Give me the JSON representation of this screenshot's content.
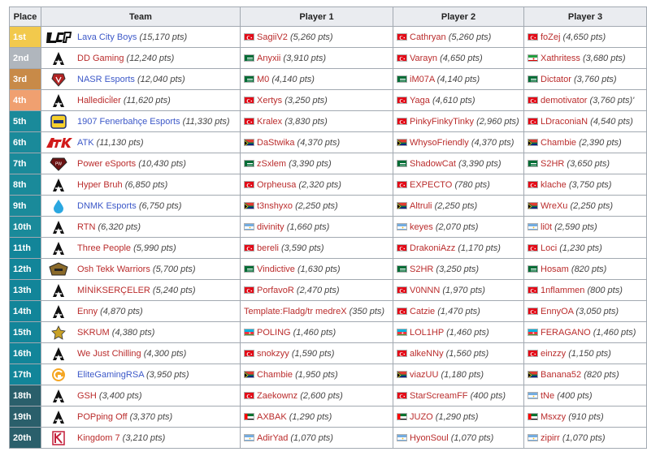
{
  "headers": {
    "place": "Place",
    "team": "Team",
    "p1": "Player 1",
    "p2": "Player 2",
    "p3": "Player 3"
  },
  "place_colors": {
    "1": "#f2c94c",
    "2": "#b0b6bd",
    "3": "#c88a48",
    "4": "#f0a070",
    "top": "#1a8a9a",
    "mid": "#128599",
    "low": "#2a5f6b"
  },
  "rows": [
    {
      "place": "1st",
      "team": "Lava City Boys",
      "team_pts": "(15,170 pts)",
      "logo": "lcb-logo",
      "team_red": false,
      "p1": {
        "flag": "tr",
        "name": "SagiiV2",
        "pts": "(5,260 pts)"
      },
      "p2": {
        "flag": "tr",
        "name": "Cathryan",
        "pts": "(5,260 pts)"
      },
      "p3": {
        "flag": "tr",
        "name": "foZej",
        "pts": "(4,650 pts)"
      }
    },
    {
      "place": "2nd",
      "team": "DD Gaming",
      "team_pts": "(12,240 pts)",
      "logo": "a-logo",
      "team_red": true,
      "p1": {
        "flag": "sa",
        "name": "Anyxii",
        "pts": "(3,910 pts)"
      },
      "p2": {
        "flag": "tr",
        "name": "Varayn",
        "pts": "(4,650 pts)"
      },
      "p3": {
        "flag": "ir",
        "name": "Xathritess",
        "pts": "(3,680 pts)"
      }
    },
    {
      "place": "3rd",
      "team": "NASR Esports",
      "team_pts": "(12,040 pts)",
      "logo": "nasr-logo",
      "team_red": false,
      "p1": {
        "flag": "sa",
        "name": "M0",
        "pts": "(4,140 pts)"
      },
      "p2": {
        "flag": "sa",
        "name": "iM07A",
        "pts": "(4,140 pts)"
      },
      "p3": {
        "flag": "sa",
        "name": "Dictator",
        "pts": "(3,760 pts)"
      }
    },
    {
      "place": "4th",
      "team": "Halledici̇ler",
      "team_pts": "(11,620 pts)",
      "logo": "a-logo",
      "team_red": true,
      "p1": {
        "flag": "tr",
        "name": "Xertys",
        "pts": "(3,250 pts)"
      },
      "p2": {
        "flag": "tr",
        "name": "Yaga",
        "pts": "(4,610 pts)"
      },
      "p3": {
        "flag": "tr",
        "name": "demotivator",
        "pts": "(3,760 pts)'"
      }
    },
    {
      "place": "5th",
      "team": "1907 Fenerbahçe Esports",
      "team_pts": "(11,330 pts)",
      "logo": "fb-logo",
      "team_red": false,
      "p1": {
        "flag": "tr",
        "name": "Kralex",
        "pts": "(3,830 pts)"
      },
      "p2": {
        "flag": "tr",
        "name": "PinkyFinkyTinky",
        "pts": "(2,960 pts)"
      },
      "p3": {
        "flag": "tr",
        "name": "LDraconiaN",
        "pts": "(4,540 pts)"
      }
    },
    {
      "place": "6th",
      "team": "ATK",
      "team_pts": "(11,130 pts)",
      "logo": "atk-logo",
      "team_red": false,
      "p1": {
        "flag": "za",
        "name": "DaStwika",
        "pts": "(4,370 pts)"
      },
      "p2": {
        "flag": "za",
        "name": "WhysoFriendly",
        "pts": "(4,370 pts)"
      },
      "p3": {
        "flag": "za",
        "name": "Chambie",
        "pts": "(2,390 pts)"
      }
    },
    {
      "place": "7th",
      "team": "Power eSports",
      "team_pts": "(10,430 pts)",
      "logo": "power-logo",
      "team_red": true,
      "p1": {
        "flag": "sa",
        "name": "zSxlem",
        "pts": "(3,390 pts)"
      },
      "p2": {
        "flag": "sa",
        "name": "ShadowCat",
        "pts": "(3,390 pts)"
      },
      "p3": {
        "flag": "sa",
        "name": "S2HR",
        "pts": "(3,650 pts)"
      }
    },
    {
      "place": "8th",
      "team": "Hyper Bruh",
      "team_pts": "(6,850 pts)",
      "logo": "a-logo",
      "team_red": true,
      "p1": {
        "flag": "tr",
        "name": "Orpheusa",
        "pts": "(2,320 pts)"
      },
      "p2": {
        "flag": "tr",
        "name": "EXPECTO",
        "pts": "(780 pts)"
      },
      "p3": {
        "flag": "tr",
        "name": "klache",
        "pts": "(3,750 pts)"
      }
    },
    {
      "place": "9th",
      "team": "DNMK Esports",
      "team_pts": "(6,750 pts)",
      "logo": "dnmk-logo",
      "team_red": false,
      "p1": {
        "flag": "za",
        "name": "t3nshyxo",
        "pts": "(2,250 pts)"
      },
      "p2": {
        "flag": "za",
        "name": "Altruli",
        "pts": "(2,250 pts)"
      },
      "p3": {
        "flag": "za",
        "name": "WreXu",
        "pts": "(2,250 pts)"
      }
    },
    {
      "place": "10th",
      "team": "RTN",
      "team_pts": "(6,320 pts)",
      "logo": "a-logo",
      "team_red": true,
      "p1": {
        "flag": "ar",
        "name": "divinity",
        "pts": "(1,660 pts)"
      },
      "p2": {
        "flag": "ar",
        "name": "keyes",
        "pts": "(2,070 pts)"
      },
      "p3": {
        "flag": "ar",
        "name": "li0t",
        "pts": "(2,590 pts)"
      }
    },
    {
      "place": "11th",
      "team": "Three People",
      "team_pts": "(5,990 pts)",
      "logo": "a-logo",
      "team_red": true,
      "p1": {
        "flag": "tr",
        "name": "bereli",
        "pts": "(3,590 pts)"
      },
      "p2": {
        "flag": "tr",
        "name": "DrakoniAzz",
        "pts": "(1,170 pts)"
      },
      "p3": {
        "flag": "tr",
        "name": "Loci",
        "pts": "(1,230 pts)"
      }
    },
    {
      "place": "12th",
      "team": "Osh Tekk Warriors",
      "team_pts": "(5,700 pts)",
      "logo": "osh-logo",
      "team_red": true,
      "p1": {
        "flag": "sa",
        "name": "Vindictive",
        "pts": "(1,630 pts)"
      },
      "p2": {
        "flag": "sa",
        "name": "S2HR",
        "pts": "(3,250 pts)"
      },
      "p3": {
        "flag": "sa",
        "name": "Hosam",
        "pts": "(820 pts)"
      }
    },
    {
      "place": "13th",
      "team": "MİNİKSERÇELER",
      "team_pts": "(5,240 pts)",
      "logo": "a-logo",
      "team_red": true,
      "p1": {
        "flag": "tr",
        "name": "PorfavoR",
        "pts": "(2,470 pts)"
      },
      "p2": {
        "flag": "tr",
        "name": "V0NNN",
        "pts": "(1,970 pts)"
      },
      "p3": {
        "flag": "tr",
        "name": "1nflammen",
        "pts": "(800 pts)"
      }
    },
    {
      "place": "14th",
      "team": "Enny",
      "team_pts": "(4,870 pts)",
      "logo": "a-logo",
      "team_red": true,
      "p1": {
        "flag": "",
        "name": "Template:Fladg/tr medreX",
        "pts": "(350 pts)",
        "template": true
      },
      "p2": {
        "flag": "tr",
        "name": "Catzie",
        "pts": "(1,470 pts)"
      },
      "p3": {
        "flag": "tr",
        "name": "EnnyOA",
        "pts": "(3,050 pts)"
      }
    },
    {
      "place": "15th",
      "team": "SKRUM",
      "team_pts": "(4,380 pts)",
      "logo": "skrum-logo",
      "team_red": true,
      "p1": {
        "flag": "az",
        "name": "POLING",
        "pts": "(1,460 pts)"
      },
      "p2": {
        "flag": "az",
        "name": "LOL1HP",
        "pts": "(1,460 pts)"
      },
      "p3": {
        "flag": "az",
        "name": "FERAGANO",
        "pts": "(1,460 pts)"
      }
    },
    {
      "place": "16th",
      "team": "We Just Chilling",
      "team_pts": "(4,300 pts)",
      "logo": "a-logo",
      "team_red": true,
      "p1": {
        "flag": "tr",
        "name": "snokzyy",
        "pts": "(1,590 pts)"
      },
      "p2": {
        "flag": "tr",
        "name": "alkeNNy",
        "pts": "(1,560 pts)"
      },
      "p3": {
        "flag": "tr",
        "name": "einzzy",
        "pts": "(1,150 pts)"
      }
    },
    {
      "place": "17th",
      "team": "EliteGamingRSA",
      "team_pts": "(3,950 pts)",
      "logo": "egr-logo",
      "team_red": false,
      "p1": {
        "flag": "za",
        "name": "Chambie",
        "pts": "(1,950 pts)"
      },
      "p2": {
        "flag": "za",
        "name": "viazUU",
        "pts": "(1,180 pts)"
      },
      "p3": {
        "flag": "za",
        "name": "Banana52",
        "pts": "(820 pts)"
      }
    },
    {
      "place": "18th",
      "team": "GSH",
      "team_pts": "(3,400 pts)",
      "logo": "a-logo",
      "team_red": true,
      "p1": {
        "flag": "tr",
        "name": "Zaekownz",
        "pts": "(2,600 pts)"
      },
      "p2": {
        "flag": "tr",
        "name": "StarScreamFF",
        "pts": "(400 pts)"
      },
      "p3": {
        "flag": "ar",
        "name": "tNe",
        "pts": "(400 pts)"
      }
    },
    {
      "place": "19th",
      "team": "POPping Off",
      "team_pts": "(3,370 pts)",
      "logo": "a-logo",
      "team_red": true,
      "p1": {
        "flag": "ae",
        "name": "AXBAK",
        "pts": "(1,290 pts)"
      },
      "p2": {
        "flag": "ae",
        "name": "JUZO",
        "pts": "(1,290 pts)"
      },
      "p3": {
        "flag": "ae",
        "name": "Msxzy",
        "pts": "(910 pts)"
      }
    },
    {
      "place": "20th",
      "team": "Kingdom 7",
      "team_pts": "(3,210 pts)",
      "logo": "k7-logo",
      "team_red": true,
      "p1": {
        "flag": "ar",
        "name": "AdirYad",
        "pts": "(1,070 pts)"
      },
      "p2": {
        "flag": "ar",
        "name": "HyonSoul",
        "pts": "(1,070 pts)"
      },
      "p3": {
        "flag": "ar",
        "name": "zipirr",
        "pts": "(1,070 pts)"
      }
    }
  ]
}
